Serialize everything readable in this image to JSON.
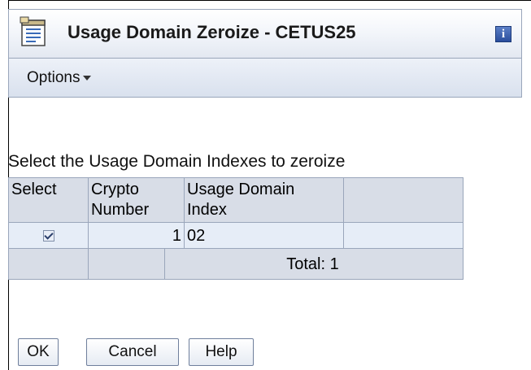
{
  "window": {
    "title": "Usage Domain Zeroize - CETUS25",
    "title_icon": "document-list-icon",
    "info_icon": "info-icon",
    "info_glyph": "i"
  },
  "menu": {
    "options_label": "Options"
  },
  "prompt": "Select the Usage Domain Indexes to zeroize",
  "table": {
    "headers": {
      "select": "Select",
      "crypto_line1": "Crypto",
      "crypto_line2": "Number",
      "usage_line1": "Usage Domain",
      "usage_line2": "Index"
    },
    "rows": [
      {
        "selected": true,
        "crypto_number": "1",
        "usage_domain_index": "02"
      }
    ],
    "footer": {
      "total": "Total: 1"
    }
  },
  "buttons": {
    "ok": "OK",
    "cancel": "Cancel",
    "help": "Help"
  },
  "colors": {
    "header_bg": "#d8dde7",
    "row_bg": "#e6edf7",
    "border": "#9aa6bb",
    "info_icon": "#2a4d9c"
  }
}
